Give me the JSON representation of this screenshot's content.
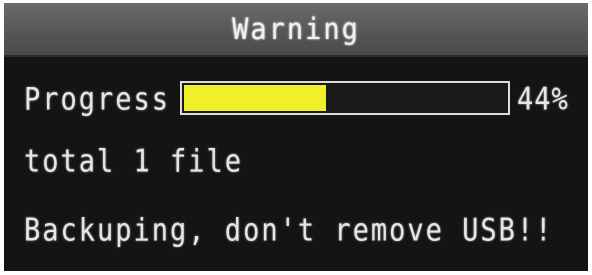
{
  "dialog": {
    "title": "Warning",
    "progress": {
      "label": "Progress",
      "value": 0.44,
      "percent_text": "44%",
      "fill_color": "#f0f028"
    },
    "files_text": "total 1 file",
    "message": "Backuping, don't remove USB!!"
  }
}
